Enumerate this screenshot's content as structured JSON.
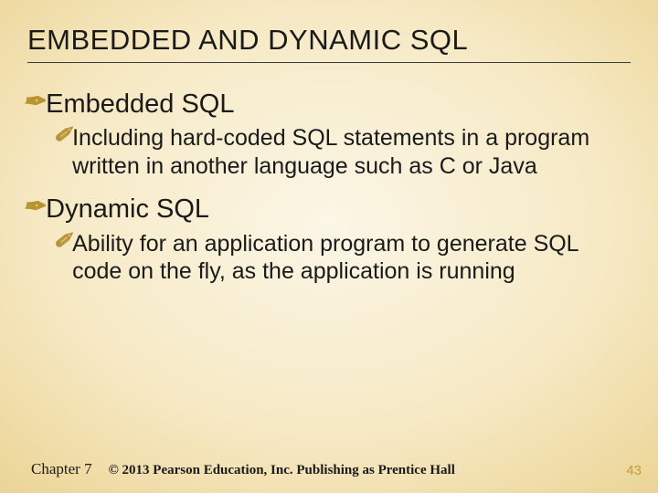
{
  "title": "EMBEDDED AND DYNAMIC SQL",
  "sections": [
    {
      "heading": "Embedded SQL",
      "sub": "Including hard-coded SQL statements in a program written in another language such as C or Java"
    },
    {
      "heading": "Dynamic SQL",
      "sub": "Ability for an application program to generate SQL code on the fly, as the application is running"
    }
  ],
  "footer": {
    "chapter": "Chapter 7",
    "copyright": "© 2013 Pearson Education, Inc.  Publishing as Prentice Hall",
    "page": "43"
  },
  "glyphs": {
    "lvl1": "✒",
    "lvl2": "✐"
  }
}
